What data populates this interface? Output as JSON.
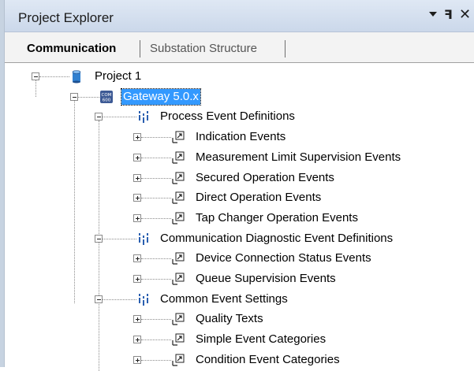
{
  "panel": {
    "title": "Project Explorer",
    "dropdown_icon": "chevron-down-icon",
    "pin_glyph": "ꟻ",
    "close_glyph": "✕"
  },
  "tabs": [
    {
      "label": "Communication",
      "active": true
    },
    {
      "label": "Substation Structure",
      "active": false
    }
  ],
  "colors": {
    "selection": "#3399ff",
    "titlebar": "#cbd8ea",
    "group_icon": "#2a5fb0",
    "project_icon": "#2f7fd0"
  },
  "tree": {
    "nodes": [
      {
        "label": "Project 1",
        "icon": "database-icon",
        "expanded": true,
        "level": 0
      },
      {
        "label": "Gateway 5.0.x",
        "icon": "com-gateway-icon",
        "badge": "COM 600",
        "expanded": true,
        "selected": true,
        "level": 1
      },
      {
        "label": "Process Event Definitions",
        "icon": "event-group-icon",
        "expanded": true,
        "level": 2
      },
      {
        "label": "Indication Events",
        "icon": "event-definition-icon",
        "expanded": false,
        "level": 3
      },
      {
        "label": "Measurement Limit Supervision Events",
        "icon": "event-definition-icon",
        "expanded": false,
        "level": 3
      },
      {
        "label": "Secured Operation Events",
        "icon": "event-definition-icon",
        "expanded": false,
        "level": 3
      },
      {
        "label": "Direct Operation Events",
        "icon": "event-definition-icon",
        "expanded": false,
        "level": 3
      },
      {
        "label": "Tap Changer Operation Events",
        "icon": "event-definition-icon",
        "expanded": false,
        "level": 3
      },
      {
        "label": "Communication Diagnostic Event Definitions",
        "icon": "event-group-icon",
        "expanded": true,
        "level": 2
      },
      {
        "label": "Device Connection Status Events",
        "icon": "event-definition-icon",
        "expanded": false,
        "level": 3
      },
      {
        "label": "Queue Supervision Events",
        "icon": "event-definition-icon",
        "expanded": false,
        "level": 3
      },
      {
        "label": "Common Event Settings",
        "icon": "event-group-icon",
        "expanded": true,
        "level": 2
      },
      {
        "label": "Quality Texts",
        "icon": "event-definition-icon",
        "expanded": false,
        "level": 3
      },
      {
        "label": "Simple Event Categories",
        "icon": "event-definition-icon",
        "expanded": false,
        "level": 3
      },
      {
        "label": "Condition Event Categories",
        "icon": "event-definition-icon",
        "expanded": false,
        "level": 3
      }
    ]
  }
}
